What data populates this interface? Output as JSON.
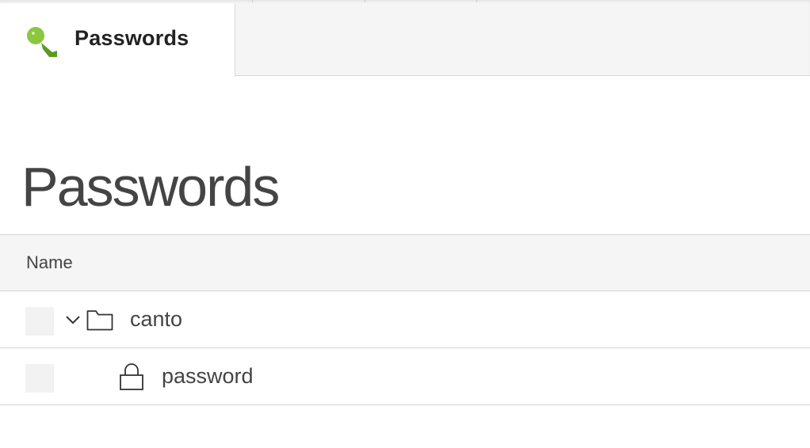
{
  "app": {
    "tab": {
      "label": "Passwords",
      "icon": "key-icon",
      "icon_color": "#8dc63f"
    }
  },
  "page": {
    "title": "Passwords"
  },
  "table": {
    "header": {
      "name": "Name"
    },
    "rows": [
      {
        "type": "folder",
        "label": "canto",
        "icon": "folder-icon",
        "expanded": true
      },
      {
        "type": "password",
        "label": "password",
        "icon": "lock-icon"
      }
    ]
  }
}
